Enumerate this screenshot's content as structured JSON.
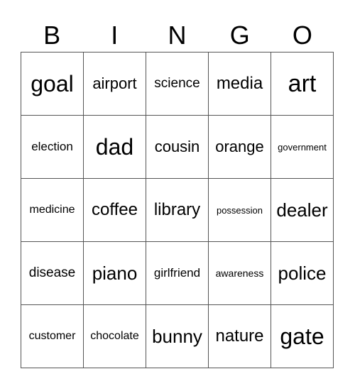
{
  "header": [
    "B",
    "I",
    "N",
    "G",
    "O"
  ],
  "grid": [
    [
      "goal",
      "airport",
      "science",
      "media",
      "art"
    ],
    [
      "election",
      "dad",
      "cousin",
      "orange",
      "government"
    ],
    [
      "medicine",
      "coffee",
      "library",
      "possession",
      "dealer"
    ],
    [
      "disease",
      "piano",
      "girlfriend",
      "awareness",
      "police"
    ],
    [
      "customer",
      "chocolate",
      "bunny",
      "nature",
      "gate"
    ]
  ]
}
